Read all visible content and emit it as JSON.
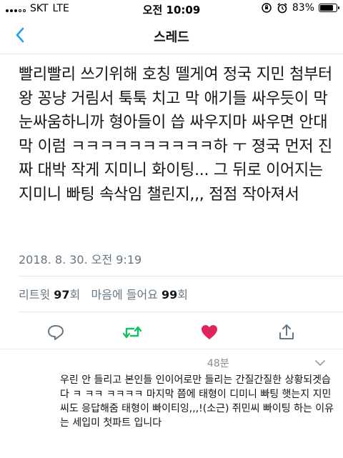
{
  "status": {
    "carrier": "SKT",
    "network": "LTE",
    "time": "오전 10:09",
    "battery": "83%",
    "battery_level": 0.83
  },
  "nav": {
    "title": "스레드",
    "back_icon": "chevron-left-icon"
  },
  "tweet": {
    "text": "빨리빨리 쓰기위해 호칭 뗄게여 정국 지민 첨부터 왕 꽁냥 거림서 툭툭 치고 막 애기들 싸우듯이 막 눈싸움하니까 형아들이 씁 싸우지마 싸우면 안대 막 이럼 ㅋㅋㅋㅋㅋㅋㅋㅋㅋㅋ하 ㅜ 졍국 먼저 진짜 대박 작게 지미니 화이팅... 그 뒤로 이어지는 지미니 빠팅 속삭임 챌린지,,, 점점 작아져서",
    "timestamp": "2018. 8. 30. 오전 9:19",
    "stats": {
      "retweet_label": "리트윗",
      "retweet_count": "97",
      "retweet_unit": "회",
      "like_label": "마음에 들어요",
      "like_count": "99",
      "like_unit": "회"
    }
  },
  "actions": {
    "reply_icon": "reply-icon",
    "retweet_icon": "retweet-icon",
    "like_icon": "heart-icon",
    "share_icon": "share-icon"
  },
  "reply": {
    "time": "48분",
    "text": "우린 안 들리고 본인들 인이어로만 들리는 간질간질한 상황되겟습다 ㅋ ㅋㅋ ㅋㅋㅋㅋ 마지막 쯤에 태형이 디미니 빠팅 햇는지 지민씨도 응답해줌 태형이 빠이티잉,,,!(소근) 쥐민씨 빠이팅 하는 이유는 세입미 첫파트 입니다"
  },
  "colors": {
    "accent": "#1da1f2",
    "retweet_active": "#17bf63",
    "like_active": "#e0245e",
    "muted": "#657786"
  }
}
